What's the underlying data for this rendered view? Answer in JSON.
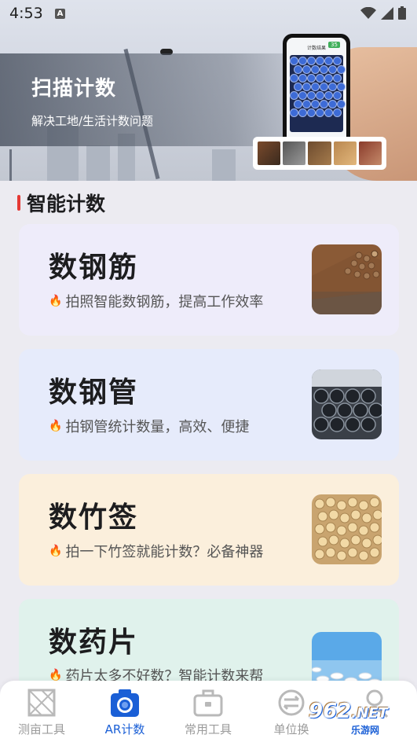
{
  "status_bar": {
    "time": "4:53",
    "app_badge": "A"
  },
  "banner": {
    "title": "扫描计数",
    "subtitle": "解决工地/生活计数问题",
    "phone_header": "计数结果",
    "phone_count": "35"
  },
  "section": {
    "title": "智能计数"
  },
  "cards": [
    {
      "title": "数钢筋",
      "desc": "拍照智能数钢筋，提高工作效率",
      "icon": "rebar-photo",
      "bg": "#eeecfa"
    },
    {
      "title": "数钢管",
      "desc": "拍钢管统计数量，高效、便捷",
      "icon": "steel-pipe-photo",
      "bg": "#e6ebfb"
    },
    {
      "title": "数竹签",
      "desc": "拍一下竹签就能计数？必备神器",
      "icon": "bamboo-stick-photo",
      "bg": "#fbefdc"
    },
    {
      "title": "数药片",
      "desc": "药片太多不好数？智能计数来帮",
      "icon": "pill-photo",
      "bg": "#e0f2ec"
    }
  ],
  "nav": {
    "items": [
      {
        "label": "测亩工具",
        "icon": "field-measure-icon",
        "active": false
      },
      {
        "label": "AR计数",
        "icon": "camera-icon",
        "active": true
      },
      {
        "label": "常用工具",
        "icon": "toolbox-icon",
        "active": false
      },
      {
        "label": "单位换",
        "icon": "unit-convert-icon",
        "active": false
      },
      {
        "label": "",
        "icon": "profile-icon",
        "active": false
      }
    ]
  },
  "watermark": {
    "logo": "962",
    "tld": ".NET",
    "sub": "乐游网"
  },
  "colors": {
    "accent": "#1a5fd6",
    "section_bar": "#e53935",
    "flame": "#e53935"
  }
}
